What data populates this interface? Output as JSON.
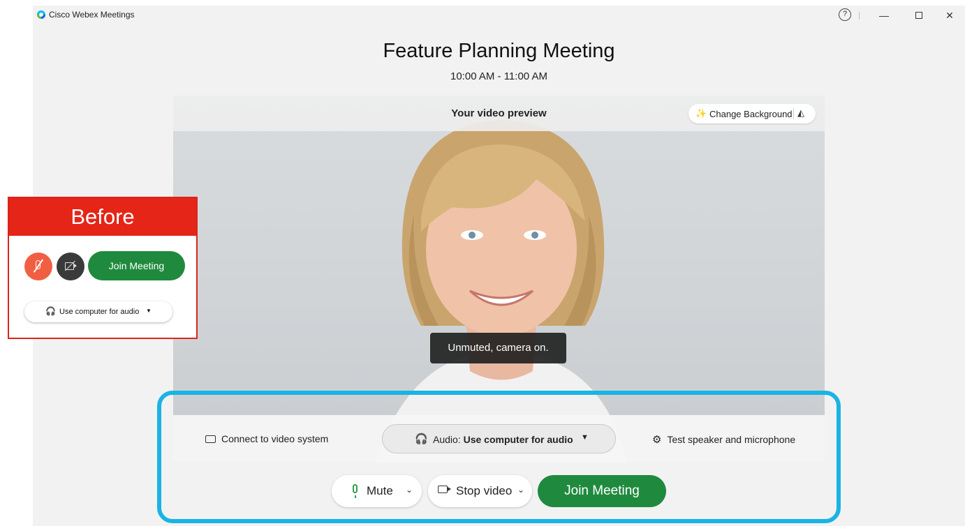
{
  "app": {
    "title": "Cisco Webex Meetings"
  },
  "window_controls": {
    "help": "?",
    "minimize": "—",
    "maximize": "",
    "close": "✕"
  },
  "meeting": {
    "title": "Feature Planning Meeting",
    "time": "10:00 AM - 11:00 AM"
  },
  "preview": {
    "title": "Your video preview",
    "change_background_label": "Change Background",
    "toast": "Unmuted, camera on."
  },
  "bottom_bar": {
    "connect_label": "Connect to video system",
    "audio_prefix": "Audio: ",
    "audio_value": "Use computer for audio",
    "test_label": "Test speaker and microphone"
  },
  "controls": {
    "mute_label": "Mute",
    "video_label": "Stop video",
    "join_label": "Join Meeting"
  },
  "before_card": {
    "header": "Before",
    "join_label": "Join Meeting",
    "audio_label": "Use computer for audio"
  },
  "colors": {
    "join_green": "#1f8a3e",
    "highlight_blue": "#19b4e3",
    "before_red": "#e42518",
    "mute_orange": "#f15f42"
  },
  "icons": [
    "webex-logo-icon",
    "help-icon",
    "minimize-icon",
    "maximize-icon",
    "close-icon",
    "magic-wand-icon",
    "mirror-icon",
    "cast-icon",
    "headset-icon",
    "gear-icon",
    "microphone-icon",
    "chevron-down-icon",
    "camera-icon",
    "microphone-off-icon",
    "camera-off-icon"
  ]
}
